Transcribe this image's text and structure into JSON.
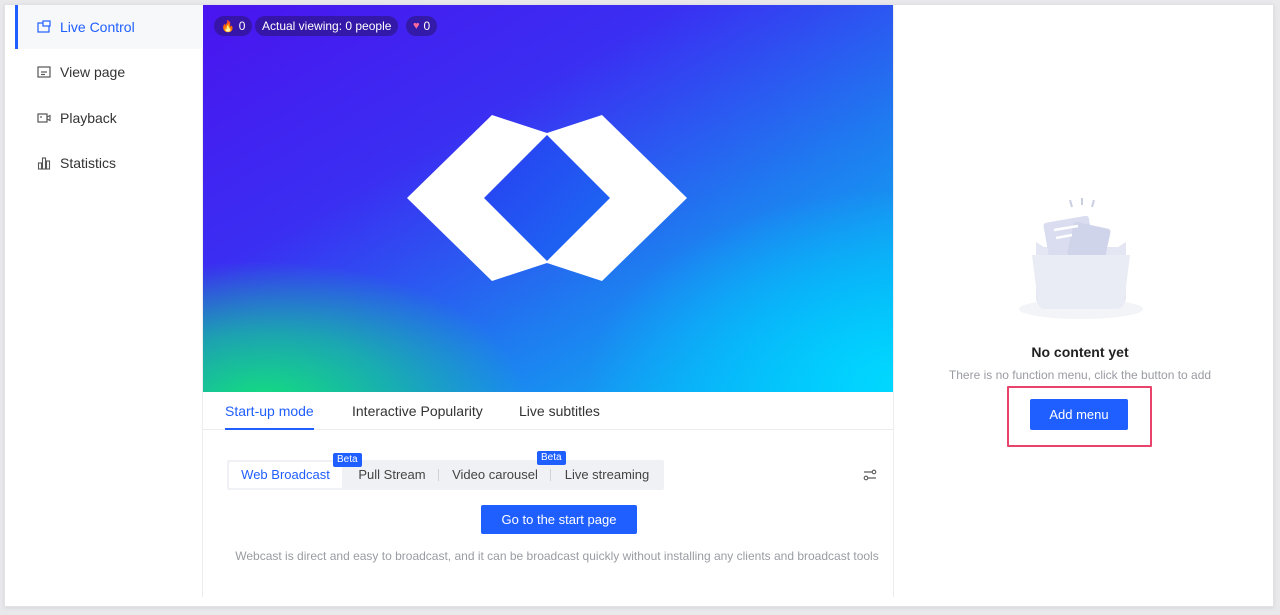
{
  "sidebar": {
    "items": [
      {
        "label": "Live Control",
        "icon": "live-control-icon",
        "active": true
      },
      {
        "label": "View page",
        "icon": "view-page-icon",
        "active": false
      },
      {
        "label": "Playback",
        "icon": "playback-icon",
        "active": false
      },
      {
        "label": "Statistics",
        "icon": "statistics-icon",
        "active": false
      }
    ]
  },
  "video": {
    "stats": {
      "popularity_value": "0",
      "viewing_label": "Actual viewing: 0 people",
      "likes_value": "0"
    }
  },
  "tabs": [
    {
      "label": "Start-up mode",
      "active": true
    },
    {
      "label": "Interactive Popularity",
      "active": false
    },
    {
      "label": "Live subtitles",
      "active": false
    }
  ],
  "modes": [
    {
      "label": "Web Broadcast",
      "active": true,
      "badge": "Beta"
    },
    {
      "label": "Pull Stream",
      "active": false,
      "badge": ""
    },
    {
      "label": "Video carousel",
      "active": false,
      "badge": "Beta"
    },
    {
      "label": "Live streaming",
      "active": false,
      "badge": ""
    }
  ],
  "start": {
    "button_label": "Go to the start page",
    "description": "Webcast is direct and easy to broadcast, and it can be broadcast quickly without installing any clients and broadcast tools"
  },
  "menu_panel": {
    "empty_title": "No content yet",
    "empty_subtitle": "There is no function menu, click the button to add",
    "add_button_label": "Add menu"
  },
  "colors": {
    "accent": "#1f5eff",
    "highlight_border": "#e8436a"
  }
}
